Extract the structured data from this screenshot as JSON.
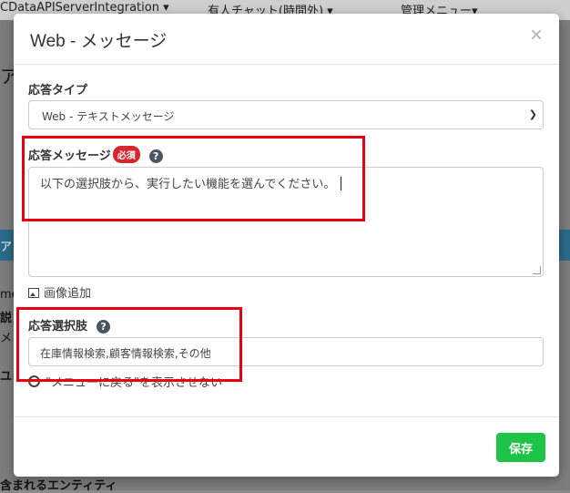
{
  "background": {
    "nav_items": [
      "CDataAPIServerIntegration ▾",
      "有人チャット(時間外) ▾",
      "管理メニュー▾"
    ],
    "side_texts": [
      "ア",
      "ア",
      "me",
      "説",
      "メ",
      "ユ"
    ],
    "bottom_text": "含まれるエンティティ"
  },
  "modal": {
    "title": "Web - メッセージ",
    "close": "×",
    "response_type": {
      "label": "応答タイプ",
      "selected": "Web - テキストメッセージ"
    },
    "response_message": {
      "label": "応答メッセージ",
      "required_badge": "必須",
      "help": "?",
      "value": "以下の選択肢から、実行したい機能を選んでください。"
    },
    "add_image": "画像追加",
    "response_options": {
      "label": "応答選択肢",
      "help": "?",
      "value": "在庫情報検索,顧客情報検索,その他"
    },
    "hide_menu_back": "\"メニューに戻る\"を表示させない",
    "save_label": "保存"
  },
  "colors": {
    "save_button": "#1ec447",
    "required_badge": "#d9262c",
    "highlight": "#e60012"
  }
}
